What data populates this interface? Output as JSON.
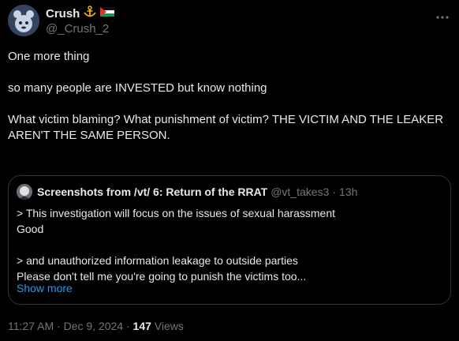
{
  "author": {
    "display_name": "Crush",
    "handle": "@_Crush_2"
  },
  "tweet": {
    "lines": [
      "One more thing",
      "so many people are INVESTED but know nothing",
      "What victim blaming? What punishment of victim? THE VICTIM AND THE LEAKER AREN'T THE SAME PERSON."
    ]
  },
  "quote": {
    "display_name": "Screenshots from /vt/ 6: Return of the RRAT",
    "handle": "@vt_takes3",
    "separator": "·",
    "time": "13h",
    "lines": [
      "> This investigation will focus on the issues of sexual harassment",
      "Good",
      "> and unauthorized information leakage to outside parties",
      "Please don't tell me you're going to punish the victims too..."
    ],
    "show_more": "Show more"
  },
  "footer": {
    "time": "11:27 AM",
    "separator": "·",
    "date": "Dec 9, 2024",
    "views_count": "147",
    "views_label": "Views"
  },
  "colors": {
    "background": "#000000",
    "text": "#e7e9ea",
    "muted": "#71767b",
    "link": "#1d9bf0",
    "border": "#2f3336"
  }
}
